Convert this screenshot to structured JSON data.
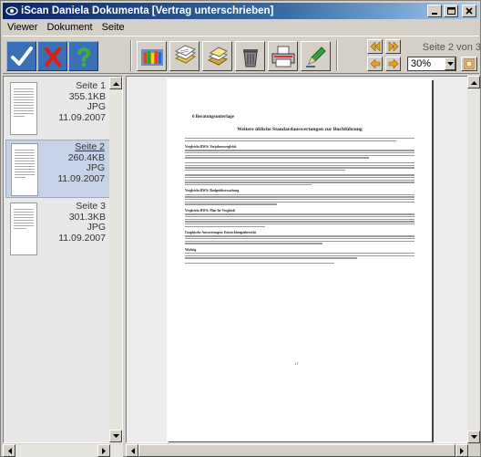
{
  "window": {
    "title": "iScan Daniela Dokumenta [Vertrag unterschrieben]"
  },
  "menu": [
    "Viewer",
    "Dokument",
    "Seite"
  ],
  "toolbar": {
    "page_info": "Seite 2 von 3",
    "zoom": "30%"
  },
  "thumbnails": [
    {
      "page": "Seite 1",
      "size": "355.1KB",
      "format": "JPG",
      "date": "11.09.2007",
      "selected": false
    },
    {
      "page": "Seite 2",
      "size": "260.4KB",
      "format": "JPG",
      "date": "11.09.2007",
      "selected": true
    },
    {
      "page": "Seite 3",
      "size": "301.3KB",
      "format": "JPG",
      "date": "11.09.2007",
      "selected": false
    }
  ],
  "document": {
    "chapter": "6   Beratungsunterlage",
    "title": "Weitere übliche Standardauswertungen zur Buchführung",
    "headings": [
      "Vergleichs-BWA: Vorjahresvergleich",
      "Vergleichs-BWA: Budgetüberwachung",
      "Vergleichs-BWA: Plan-Ist-Vergleich",
      "Graphische Auswertungen: Entwicklungsübersicht",
      "Wichtig"
    ],
    "page_number": "17"
  }
}
